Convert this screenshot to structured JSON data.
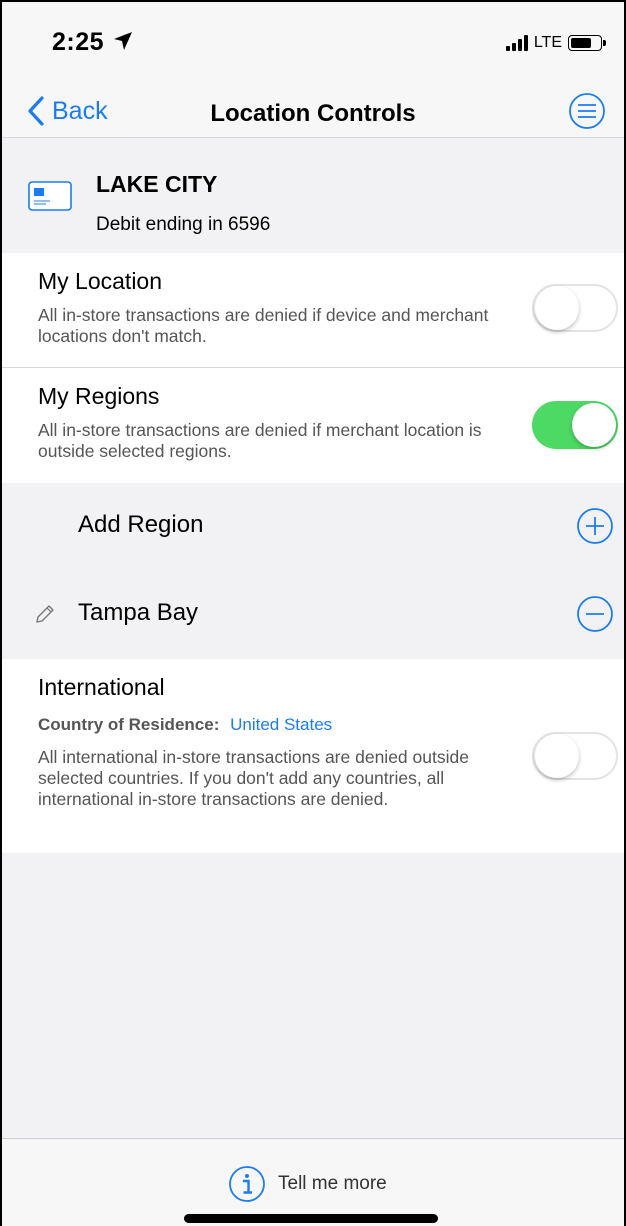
{
  "status_bar": {
    "time": "2:25",
    "network": "LTE"
  },
  "nav": {
    "back_label": "Back",
    "title": "Location Controls"
  },
  "card": {
    "name": "LAKE CITY",
    "subtitle": "Debit ending in 6596"
  },
  "my_location": {
    "title": "My Location",
    "description": "All in-store transactions are denied if device and merchant locations don't match.",
    "enabled": false
  },
  "my_regions": {
    "title": "My Regions",
    "description": "All in-store transactions are denied if merchant location is outside selected regions.",
    "enabled": true,
    "add_label": "Add Region",
    "regions": [
      {
        "name": "Tampa Bay"
      }
    ]
  },
  "international": {
    "title": "International",
    "residence_label": "Country of Residence:",
    "residence_value": "United States",
    "description": "All international in-store transactions are denied outside selected countries. If you don't add any countries, all international in-store transactions are denied.",
    "enabled": false
  },
  "footer": {
    "tell_more_label": "Tell me more"
  },
  "colors": {
    "accent": "#1a7cf5",
    "toggle_on": "#4cd964",
    "background": "#f2f2f4"
  }
}
